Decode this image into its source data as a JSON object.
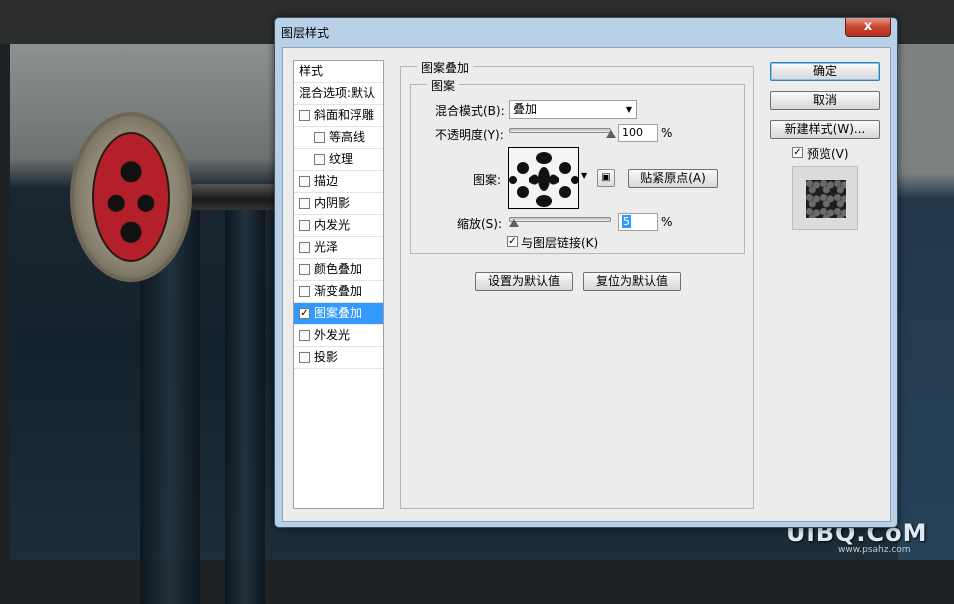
{
  "dialog": {
    "title": "图层样式",
    "close_label": "x"
  },
  "style_list": {
    "header_label": "样式",
    "blend_options_label": "混合选项:默认",
    "items": [
      {
        "label": "斜面和浮雕",
        "checked": false,
        "indent": false
      },
      {
        "label": "等高线",
        "checked": false,
        "indent": true
      },
      {
        "label": "纹理",
        "checked": false,
        "indent": true
      },
      {
        "label": "描边",
        "checked": false,
        "indent": false
      },
      {
        "label": "内阴影",
        "checked": false,
        "indent": false
      },
      {
        "label": "内发光",
        "checked": false,
        "indent": false
      },
      {
        "label": "光泽",
        "checked": false,
        "indent": false
      },
      {
        "label": "颜色叠加",
        "checked": false,
        "indent": false
      },
      {
        "label": "渐变叠加",
        "checked": false,
        "indent": false
      },
      {
        "label": "图案叠加",
        "checked": true,
        "indent": false,
        "selected": true
      },
      {
        "label": "外发光",
        "checked": false,
        "indent": false
      },
      {
        "label": "投影",
        "checked": false,
        "indent": false
      }
    ],
    "check_mark": "✓"
  },
  "pattern_overlay": {
    "section_title": "图案叠加",
    "group_title": "图案",
    "blend_mode_label": "混合模式(B):",
    "blend_mode_value": "叠加",
    "opacity_label": "不透明度(Y):",
    "opacity_value": "100",
    "opacity_level": 1.0,
    "percent_unit": "%",
    "pattern_label": "图案:",
    "snap_origin_label": "贴紧原点(A)",
    "scale_label": "缩放(S):",
    "scale_value": "5",
    "scale_level": 0.05,
    "link_with_layer_label": "与图层链接(K)",
    "link_with_layer_checked": true,
    "make_default_label": "设置为默认值",
    "reset_default_label": "复位为默认值"
  },
  "side_buttons": {
    "ok_label": "确定",
    "cancel_label": "取消",
    "new_style_label": "新建样式(W)...",
    "preview_label": "预览(V)",
    "preview_checked": true
  },
  "watermark": {
    "text": "UiBQ.CoM",
    "sub": "www.psahz.com"
  },
  "colors": {
    "selection": "#3399ff",
    "dialog_frame": "#b9d1e6",
    "close_button": "#c8452e"
  }
}
